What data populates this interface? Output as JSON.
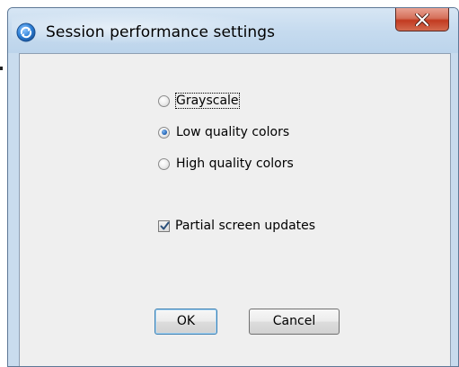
{
  "window": {
    "title": "Session performance settings",
    "close_icon": "close-icon",
    "app_icon": "refresh-circle-icon"
  },
  "colors": {
    "titlebar": "#c6dbef",
    "close_button": "#c8442a",
    "client_bg": "#efefef",
    "radio_selected": "#1f5fb0"
  },
  "color_options": {
    "items": [
      {
        "label": "Grayscale",
        "selected": false,
        "focused": true
      },
      {
        "label": "Low quality colors",
        "selected": true,
        "focused": false
      },
      {
        "label": "High quality colors",
        "selected": false,
        "focused": false
      }
    ]
  },
  "partial_updates": {
    "label": "Partial screen updates",
    "checked": true
  },
  "buttons": {
    "ok_label": "OK",
    "cancel_label": "Cancel"
  }
}
